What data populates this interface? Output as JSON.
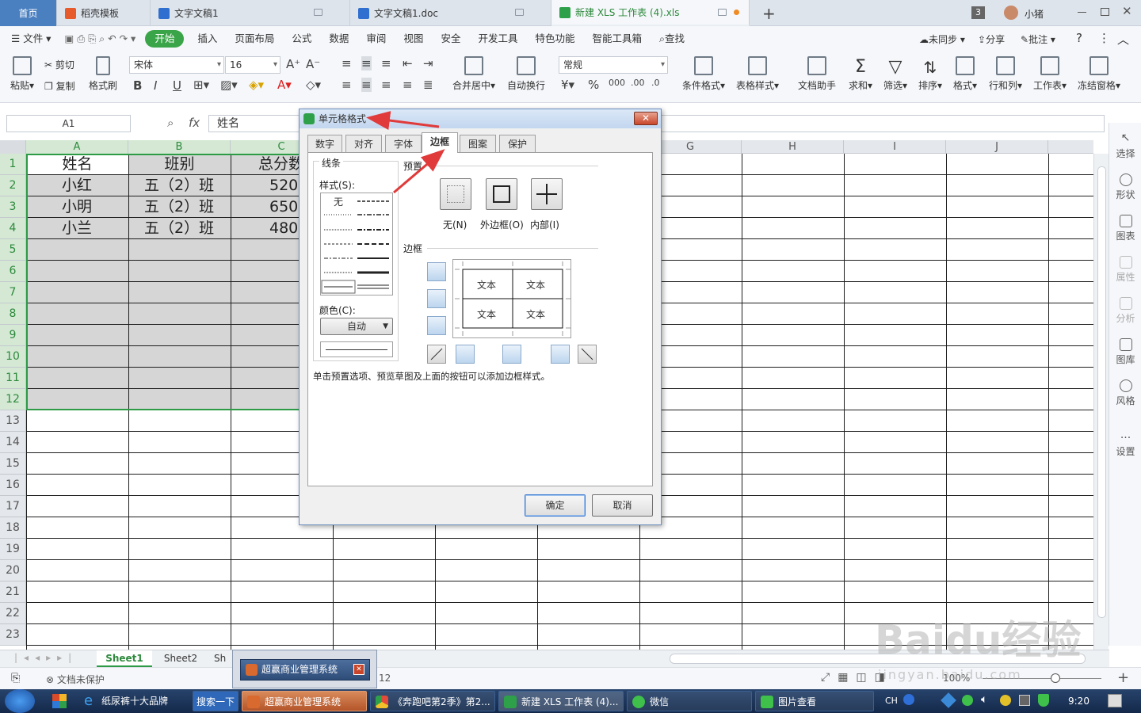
{
  "titlebar": {
    "tabs": [
      {
        "label": "首页",
        "icon": "home"
      },
      {
        "label": "稻壳模板",
        "icon": "docer-icon"
      },
      {
        "label": "文字文稿1",
        "icon": "word-icon"
      },
      {
        "label": "文字文稿1.doc",
        "icon": "word-icon"
      },
      {
        "label": "新建 XLS 工作表 (4).xls",
        "icon": "sheet-icon"
      }
    ],
    "count_badge": "3",
    "user_name": "小猪",
    "add_tab": "+"
  },
  "menubar": {
    "file": "文件",
    "items": [
      "开始",
      "插入",
      "页面布局",
      "公式",
      "数据",
      "审阅",
      "视图",
      "安全",
      "开发工具",
      "特色功能",
      "智能工具箱"
    ],
    "search": "查找",
    "sync": "未同步",
    "share": "分享",
    "comment": "批注",
    "help": "?"
  },
  "ribbon": {
    "paste": "粘贴",
    "cut": "剪切",
    "copy": "复制",
    "format_painter": "格式刷",
    "font_name": "宋体",
    "font_size": "16",
    "merge_center": "合并居中",
    "wrap_text": "自动换行",
    "number_format": "常规",
    "cond_format": "条件格式",
    "table_style": "表格样式",
    "doc_assistant": "文档助手",
    "sum": "求和",
    "filter": "筛选",
    "sort": "排序",
    "format": "格式",
    "row_col": "行和列",
    "worksheet": "工作表",
    "freeze": "冻结窗格"
  },
  "formula": {
    "cell_ref": "A1",
    "fx": "fx",
    "value": "姓名"
  },
  "sheet": {
    "columns": [
      "A",
      "B",
      "C",
      "D",
      "E",
      "F",
      "G",
      "H",
      "I",
      "J"
    ],
    "rows": [
      "1",
      "2",
      "3",
      "4",
      "5",
      "6",
      "7",
      "8",
      "9",
      "10",
      "11",
      "12",
      "13",
      "14",
      "15",
      "16",
      "17",
      "18",
      "19",
      "20",
      "21",
      "22",
      "23"
    ],
    "cells": [
      [
        "姓名",
        "班别",
        "总分数"
      ],
      [
        "小红",
        "五（2）班",
        "520"
      ],
      [
        "小明",
        "五（2）班",
        "650"
      ],
      [
        "小兰",
        "五（2）班",
        "480"
      ]
    ]
  },
  "right_panel": [
    "选择",
    "形状",
    "图表",
    "属性",
    "分析",
    "图库",
    "风格",
    "设置"
  ],
  "dialog": {
    "title": "单元格格式",
    "tabs": [
      "数字",
      "对齐",
      "字体",
      "边框",
      "图案",
      "保护"
    ],
    "active_tab": "边框",
    "line_group": "线条",
    "style_label": "样式(S):",
    "none_style": "无",
    "color_label": "颜色(C):",
    "color_value": "自动",
    "preset_group": "预置",
    "preset_none": "无(N)",
    "preset_outline": "外边框(O)",
    "preset_inside": "内部(I)",
    "border_group": "边框",
    "preview_text": [
      "文本",
      "文本",
      "文本",
      "文本"
    ],
    "hint": "单击预置选项、预览草图及上面的按钮可以添加边框样式。",
    "ok": "确定",
    "cancel": "取消",
    "accent": "#e03a3a"
  },
  "sheet_tabs": [
    "Sheet1",
    "Sheet2",
    "Sh"
  ],
  "status": {
    "protect": "文档未保护",
    "count": "12",
    "zoom": "100%"
  },
  "popup": {
    "label": "超赢商业管理系统"
  },
  "taskbar": {
    "items": [
      "纸尿裤十大品牌",
      "搜索一下",
      "超赢商业管理系统",
      "《奔跑吧第2季》第2...",
      "新建 XLS 工作表 (4)...",
      "微信",
      "图片查看"
    ],
    "ime": "CH",
    "time": "9:20"
  },
  "watermark": "Baidu经验",
  "watermark_url": "jingyan.baidu.com"
}
